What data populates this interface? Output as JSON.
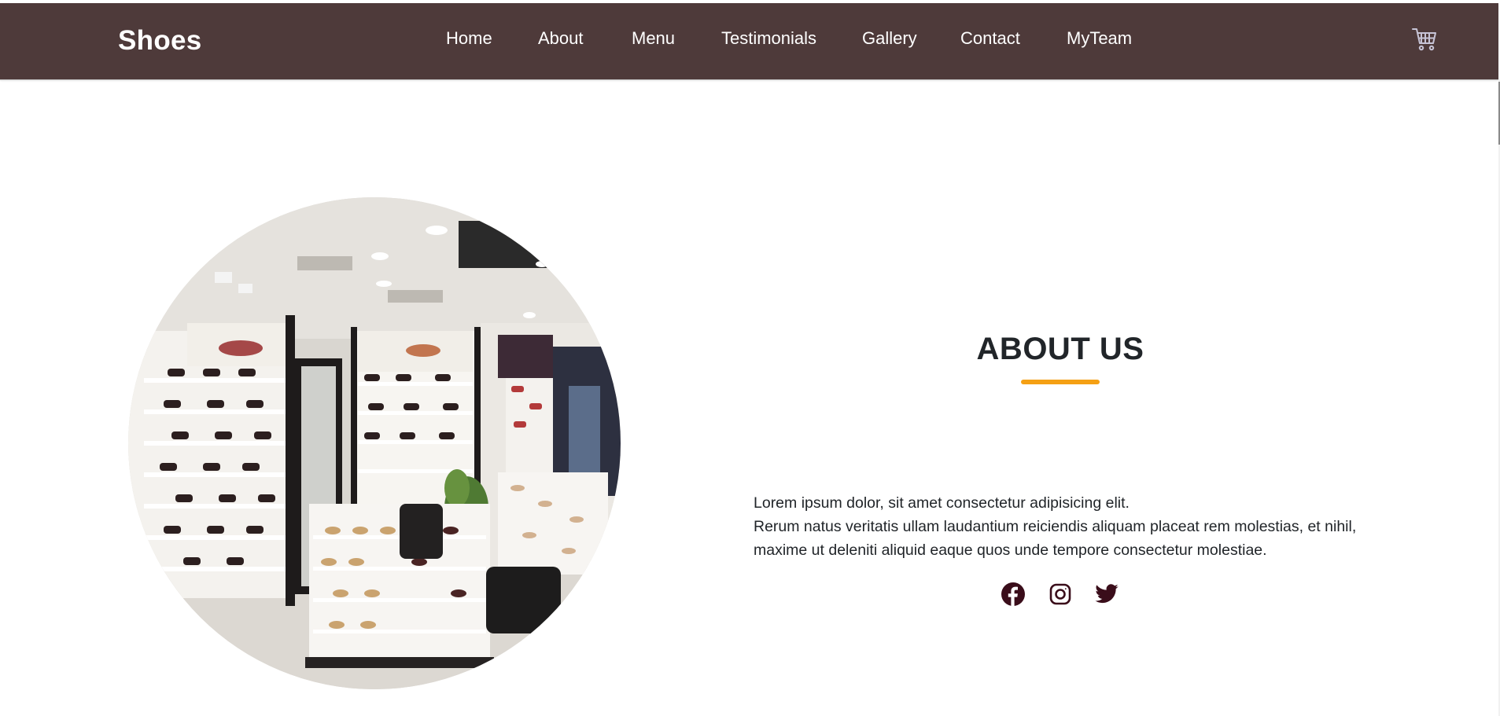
{
  "navbar": {
    "brand": "Shoes",
    "links": [
      "Home",
      "About",
      "Menu",
      "Testimonials",
      "Gallery",
      "Contact",
      "MyTeam"
    ],
    "background": "#4e3a3a",
    "cart_icon": "cart-icon"
  },
  "about": {
    "title": "ABOUT US",
    "accent": "#f5a014",
    "line1": "Lorem ipsum dolor, sit amet consectetur adipisicing elit.",
    "line2": "Rerum natus veritatis ullam laudantium reiciendis aliquam placeat rem molestias, et nihil, maxime ut deleniti aliquid eaque quos unde tempore consectetur molestiae.",
    "image": "shoe-store-interior",
    "social": [
      "facebook-icon",
      "instagram-icon",
      "twitter-icon"
    ],
    "social_color": "#3a0d1a"
  }
}
